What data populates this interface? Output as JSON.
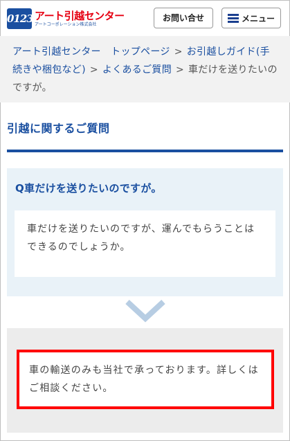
{
  "header": {
    "logo_mark": "0123",
    "logo_name": "アート引越センター",
    "logo_sub": "アートコーポレーション株式会社",
    "contact_label": "お問い合せ",
    "menu_label": "メニュー"
  },
  "breadcrumb": {
    "items": [
      "アート引越センター　トップページ",
      "お引越しガイド(手続きや梱包など)",
      "よくあるご質問"
    ],
    "separator": ">",
    "current": "車だけを送りたいのですが。"
  },
  "page": {
    "title": "引越に関するご質問"
  },
  "question": {
    "title": "Q車だけを送りたいのですが。",
    "body": "車だけを送りたいのですが、運んでもらうことはできるのでしょうか。"
  },
  "answer": {
    "body": "車の輸送のみも当社で承っております。詳しくはご相談ください。"
  },
  "colors": {
    "brand_blue": "#1a4fa0",
    "brand_red": "#e60012",
    "highlight_red": "#ff0000",
    "question_bg": "#e9f2f8",
    "answer_bg": "#ececec"
  }
}
